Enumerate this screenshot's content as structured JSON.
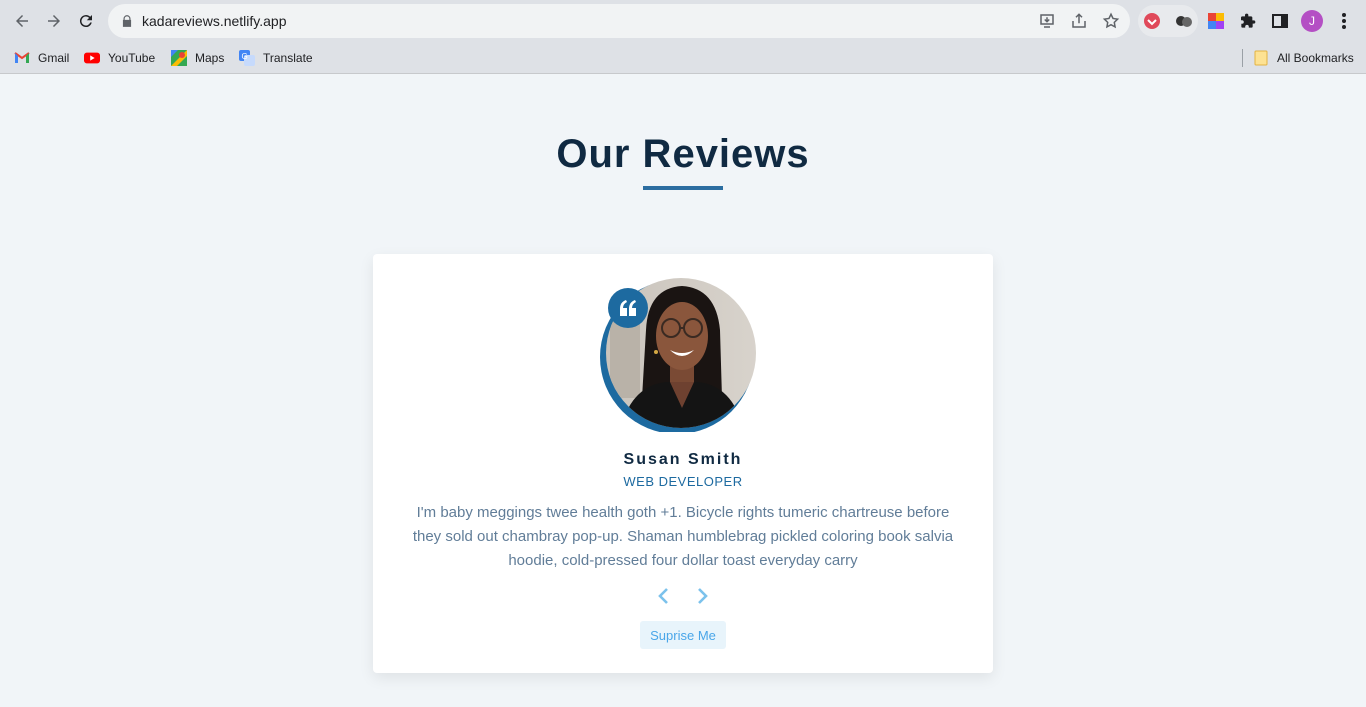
{
  "browser": {
    "url": "kadareviews.netlify.app",
    "avatar_letter": "J",
    "bookmarks": [
      {
        "label": "Gmail",
        "icon": "gmail-icon"
      },
      {
        "label": "YouTube",
        "icon": "youtube-icon"
      },
      {
        "label": "Maps",
        "icon": "maps-icon"
      },
      {
        "label": "Translate",
        "icon": "translate-icon"
      }
    ],
    "all_bookmarks": "All Bookmarks"
  },
  "page": {
    "title": "Our Reviews",
    "accent_color": "#2c6ea1"
  },
  "review": {
    "name": "Susan Smith",
    "job": "WEB DEVELOPER",
    "text": "I'm baby meggings twee health goth +1. Bicycle rights tumeric chartreuse before they sold out chambray pop-up. Shaman humblebrag pickled coloring book salvia hoodie, cold-pressed four dollar toast everyday carry",
    "surprise_label": "Suprise Me"
  }
}
